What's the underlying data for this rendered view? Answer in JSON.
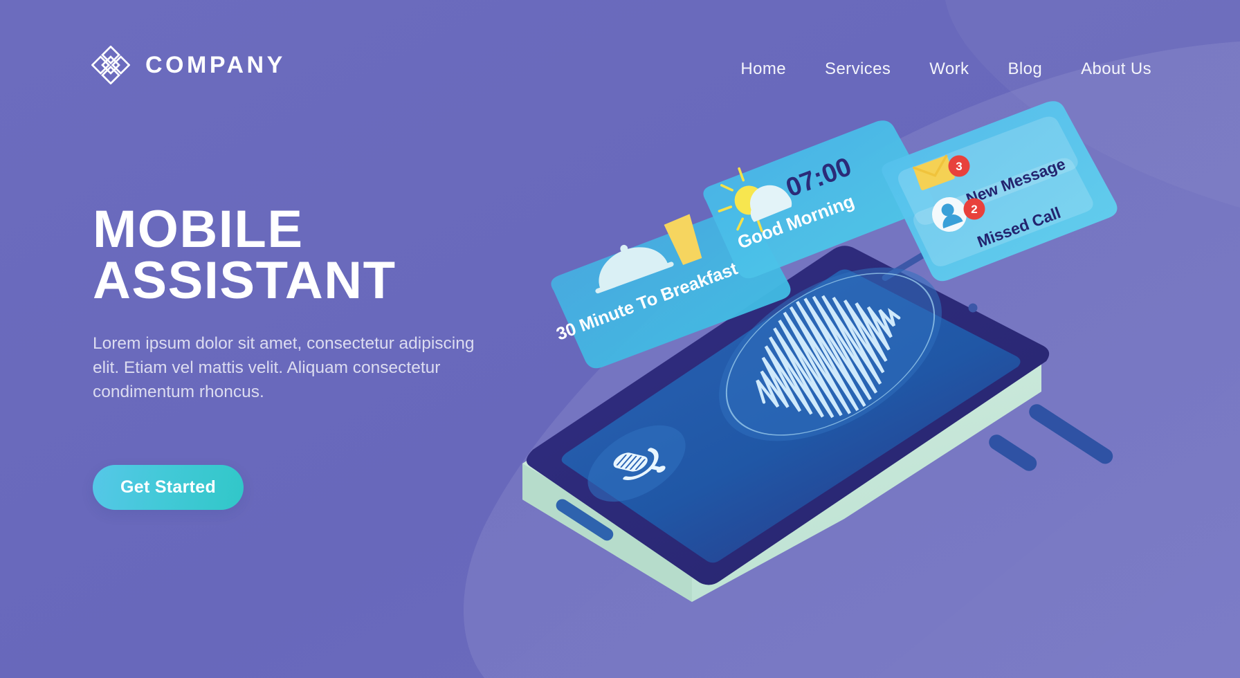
{
  "page": {
    "background_color": "#6969bc",
    "accent_color": "#43c9d8"
  },
  "header": {
    "logo_icon": "interlocking-diamonds-logo",
    "brand_name": "COMPANY",
    "nav_items": [
      {
        "label": "Home"
      },
      {
        "label": "Services"
      },
      {
        "label": "Work"
      },
      {
        "label": "Blog"
      },
      {
        "label": "About Us"
      }
    ]
  },
  "hero": {
    "title_line1": "MOBILE",
    "title_line2": "ASSISTANT",
    "paragraph": "Lorem ipsum dolor sit amet, consectetur adipiscing elit. Etiam vel mattis velit. Aliquam consectetur condimentum rhoncus.",
    "cta_label": "Get Started"
  },
  "illustration": {
    "breakfast_card": {
      "icon": "food-cloche-icon",
      "drink_icon": "coffee-cup-icon",
      "label": "30 Minute To Breakfast"
    },
    "weather_card": {
      "icon": "sun-cloud-icon",
      "time": "07:00",
      "greeting": "Good Morning"
    },
    "notification_card": {
      "rows": [
        {
          "icon": "envelope-icon",
          "badge": "3",
          "label": "New Message"
        },
        {
          "icon": "person-icon",
          "badge": "2",
          "label": "Missed Call"
        }
      ],
      "badge_color": "#e8413c"
    },
    "phone": {
      "screen_icon": "voice-waveform-icon",
      "mic_button_icon": "microphone-icon",
      "bezel_color": "#2c2a77",
      "screen_color": "#2258a8",
      "body_color": "#cfe9dc"
    }
  }
}
